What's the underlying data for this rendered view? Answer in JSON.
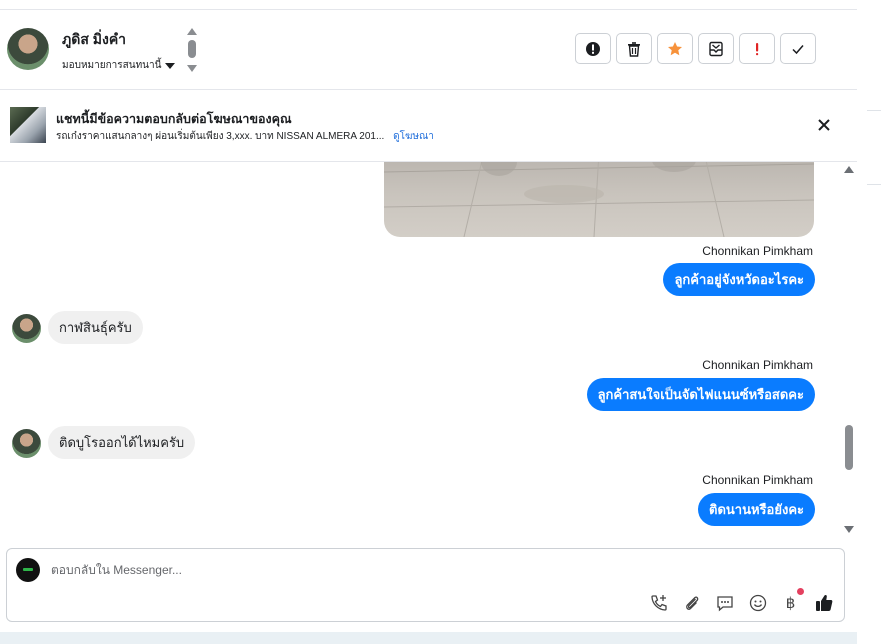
{
  "header": {
    "contact_name": "ภูดิส มิ่งคำ",
    "assign_label": "มอบหมายการสนทนานี้"
  },
  "actions": [
    {
      "name": "spam-icon"
    },
    {
      "name": "trash-icon"
    },
    {
      "name": "star-icon",
      "color": "#f7923b"
    },
    {
      "name": "archive-icon"
    },
    {
      "name": "follow-up-icon",
      "color": "#e02424"
    },
    {
      "name": "check-icon"
    }
  ],
  "ad_banner": {
    "title": "แชทนี้มีข้อความตอบกลับต่อโฆษณาของคุณ",
    "subtitle": "รถเก๋งราคาแสนกลางๆ ผ่อนเริ่มต้นเพียง 3,xxx. บาท NISSAN ALMERA 201...",
    "link": "ดูโฆษณา"
  },
  "messages": [
    {
      "direction": "out",
      "sender": "Chonnikan Pimkham",
      "text": "ลูกค้าอยู่จังหวัดอะไรคะ"
    },
    {
      "direction": "in",
      "text": "กาฬสินธุ์ครับ"
    },
    {
      "direction": "out",
      "sender": "Chonnikan Pimkham",
      "text": "ลูกค้าสนใจเป็นจัดไฟแนนซ์หรือสดคะ"
    },
    {
      "direction": "in",
      "text": "ติดบูโรออกได้ไหมครับ"
    },
    {
      "direction": "out",
      "sender": "Chonnikan Pimkham",
      "text": "ติดนานหรือยังคะ"
    }
  ],
  "composer": {
    "placeholder": "ตอบกลับใน Messenger...",
    "tools": [
      "call-add-icon",
      "attach-icon",
      "saved-reply-icon",
      "emoji-icon",
      "payment-baht-icon",
      "like-icon"
    ]
  },
  "colors": {
    "outgoing_bubble": "#0a7cff",
    "incoming_bubble": "#f0f0f0",
    "link": "#216fdb"
  }
}
